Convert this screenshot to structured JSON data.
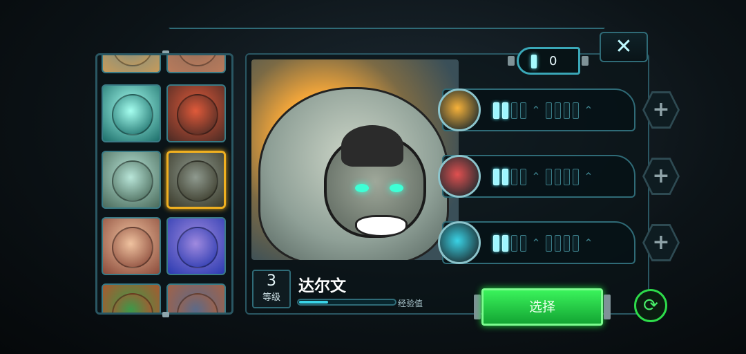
{
  "counter": {
    "value": "0"
  },
  "close": {
    "icon": "close-x-icon",
    "glyph": "✕"
  },
  "roster": {
    "heroes": [
      {
        "name": "hero-partial-top-left",
        "colors": [
          "#6a8a8c",
          "#c79b5a"
        ]
      },
      {
        "name": "hero-partial-top-right",
        "colors": [
          "#8a6a5a",
          "#b97b5b"
        ]
      },
      {
        "name": "hero-ghost-wolf",
        "colors": [
          "#a6fff0",
          "#1c6e6a"
        ]
      },
      {
        "name": "hero-red-robot",
        "colors": [
          "#e05a3a",
          "#4a2a24"
        ]
      },
      {
        "name": "hero-bubble-pilot",
        "colors": [
          "#b9e6d9",
          "#4a6a5a"
        ]
      },
      {
        "name": "hero-gorilla-darwin",
        "colors": [
          "#8f9a8f",
          "#3a3a2a"
        ],
        "selected": true
      },
      {
        "name": "hero-red-head-girl",
        "colors": [
          "#f0c3a0",
          "#8a4a3a"
        ]
      },
      {
        "name": "hero-purple-rock",
        "colors": [
          "#a08adf",
          "#2a3ab0"
        ]
      },
      {
        "name": "hero-partial-bottom-left",
        "colors": [
          "#3a9a4a",
          "#c04a2a"
        ]
      },
      {
        "name": "hero-partial-bottom-right",
        "colors": [
          "#5a6a8a",
          "#b0603a"
        ]
      }
    ]
  },
  "hero": {
    "level": "3",
    "level_label": "等级",
    "name": "达尔文",
    "xp_label": "经验值",
    "xp_fraction": 0.3
  },
  "skills": [
    {
      "icon": "fireball-skill-icon",
      "color": "#f7b23a",
      "filled": 2
    },
    {
      "icon": "punch-skill-icon",
      "color": "#e05050",
      "filled": 2
    },
    {
      "icon": "robot-armor-skill-icon",
      "color": "#3ad3e6",
      "filled": 2
    }
  ],
  "buttons": {
    "select": "选择",
    "plus": "+",
    "reset_glyph": "⟳"
  }
}
